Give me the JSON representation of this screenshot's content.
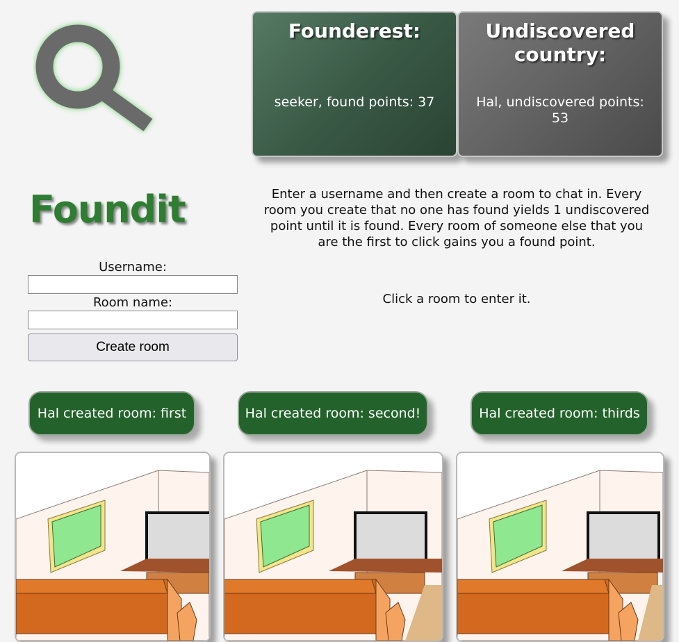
{
  "app": {
    "name": "Foundit"
  },
  "logo": {
    "icon": "magnifier-icon",
    "color": "#6b6b6b",
    "glow": "#6bcf6b"
  },
  "leaderboard": {
    "founderest": {
      "title": "Founderest:",
      "text": "seeker, found points: 37"
    },
    "undiscovered": {
      "title": "Undiscovered country:",
      "text": "Hal, undiscovered points: 53"
    }
  },
  "intro": "Enter a username and then create a room to chat in. Every room you create that no one has found yields 1 undiscovered point until it is found. Every room of someone else that you are the first to click gains you a found point.",
  "hint": "Click a room to enter it.",
  "form": {
    "username_label": "Username:",
    "username_value": "",
    "room_label": "Room name:",
    "room_value": "",
    "create_label": "Create room"
  },
  "rooms": [
    {
      "label": "Hal created room: first",
      "image": "room-scene-icon"
    },
    {
      "label": "Hal created room: second!",
      "image": "room-scene-icon"
    },
    {
      "label": "Hal created room: thirds",
      "image": "room-scene-icon"
    }
  ],
  "colors": {
    "brand_green": "#2e7d32",
    "room_button_green": "#23632b",
    "founderest_card": "#3a5a46",
    "undiscovered_card": "#5c5c5c"
  }
}
